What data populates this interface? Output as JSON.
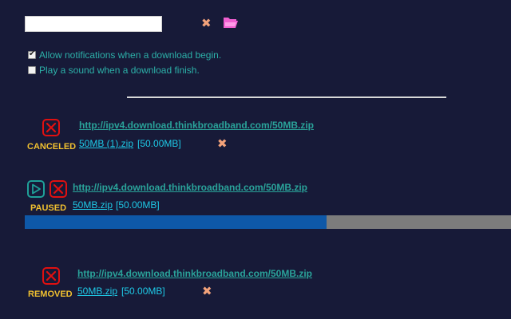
{
  "toolbar": {
    "directory_value": "",
    "clear_icon": "close-icon",
    "folder_icon": "folder-open-icon"
  },
  "options": {
    "notify_label": "Allow notifications when a download begin.",
    "notify_checked": true,
    "sound_label": "Play a sound when a download finish.",
    "sound_checked": false
  },
  "downloads": [
    {
      "status": "CANCELED",
      "url": "http://ipv4.download.thinkbroadband.com/50MB.zip",
      "filename": "50MB (1).zip",
      "size": "[50.00MB]"
    },
    {
      "status": "PAUSED",
      "url": "http://ipv4.download.thinkbroadband.com/50MB.zip",
      "filename": "50MB.zip",
      "size": "[50.00MB]",
      "progress": 0.62
    },
    {
      "status": "REMOVED",
      "url": "http://ipv4.download.thinkbroadband.com/50MB.zip",
      "filename": "50MB.zip",
      "size": "[50.00MB]"
    }
  ],
  "colors": {
    "background": "#171a38",
    "accent_teal": "#2aa39a",
    "status_yellow": "#f0c030",
    "cancel_red": "#e01010",
    "progress_fill": "#0e58a8",
    "progress_track": "#7c7c7c"
  }
}
